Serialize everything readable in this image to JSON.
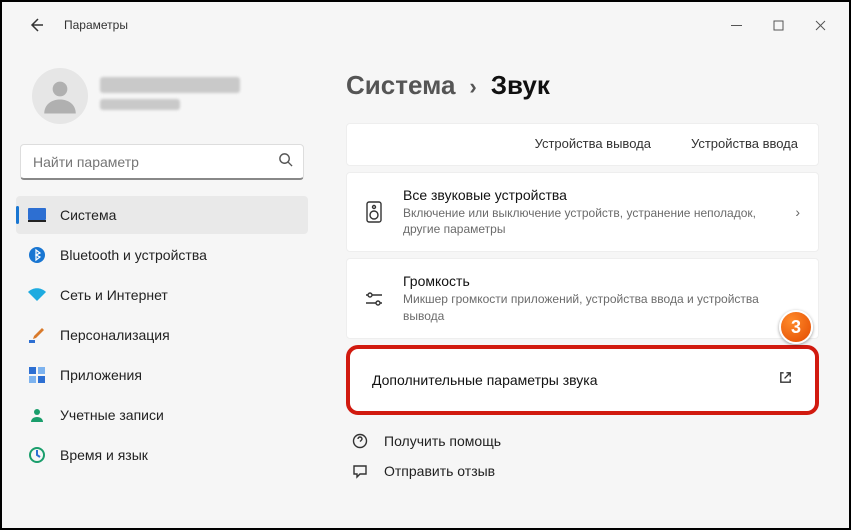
{
  "window": {
    "title": "Параметры"
  },
  "profile": {
    "name": "———",
    "email": "———"
  },
  "search": {
    "placeholder": "Найти параметр"
  },
  "sidebar": {
    "items": [
      {
        "label": "Система"
      },
      {
        "label": "Bluetooth и устройства"
      },
      {
        "label": "Сеть и Интернет"
      },
      {
        "label": "Персонализация"
      },
      {
        "label": "Приложения"
      },
      {
        "label": "Учетные записи"
      },
      {
        "label": "Время и язык"
      }
    ]
  },
  "breadcrumb": {
    "parent": "Система",
    "sep": "›",
    "current": "Звук"
  },
  "tabs": {
    "output": "Устройства вывода",
    "input": "Устройства ввода"
  },
  "cards": {
    "all_devices": {
      "title": "Все звуковые устройства",
      "sub": "Включение или выключение устройств, устранение неполадок, другие параметры"
    },
    "volume": {
      "title": "Громкость",
      "sub": "Микшер громкости приложений, устройства ввода и устройства вывода"
    },
    "more": {
      "title": "Дополнительные параметры звука"
    }
  },
  "help": {
    "get_help": "Получить помощь",
    "feedback": "Отправить отзыв"
  },
  "callout": {
    "num": "3"
  }
}
